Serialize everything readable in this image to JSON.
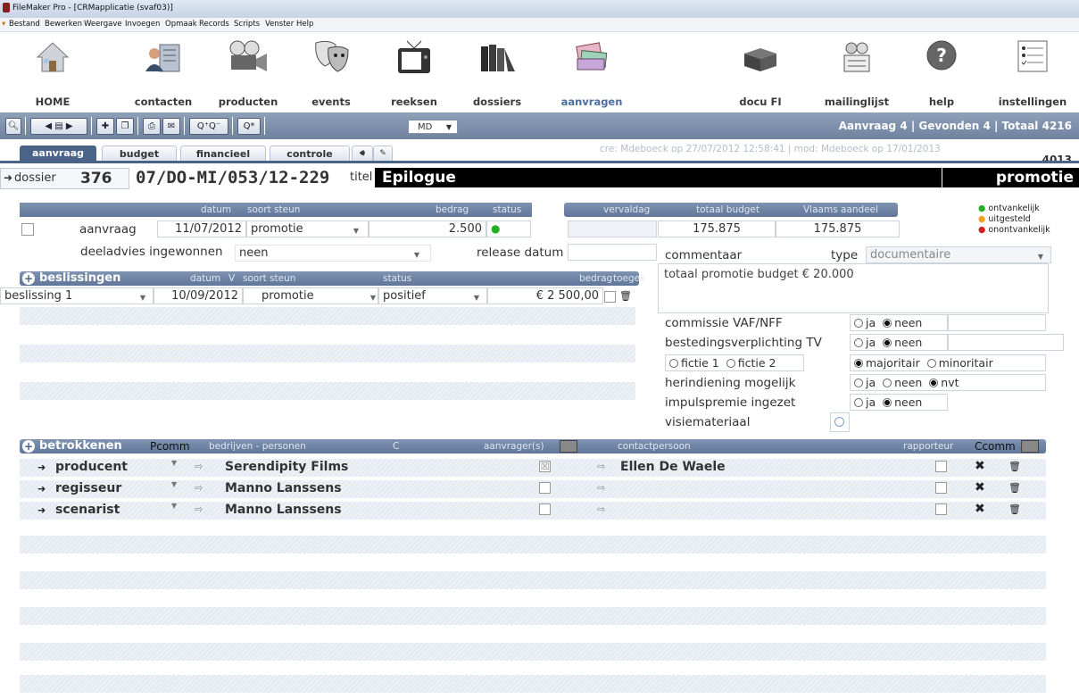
{
  "window": {
    "title": "FileMaker Pro - [CRMapplicatie (svaf03)]"
  },
  "menu": [
    "Bestand",
    "Bewerken",
    "Weergave",
    "Invoegen",
    "Opmaak",
    "Records",
    "Scripts",
    "Venster",
    "Help"
  ],
  "nav": [
    {
      "label": "HOME",
      "icon": "home-icon"
    },
    {
      "label": "contacten",
      "icon": "contacts-icon"
    },
    {
      "label": "producten",
      "icon": "film-camera-icon"
    },
    {
      "label": "events",
      "icon": "theater-masks-icon"
    },
    {
      "label": "reeksen",
      "icon": "television-icon"
    },
    {
      "label": "dossiers",
      "icon": "binders-icon"
    },
    {
      "label": "aanvragen",
      "icon": "documents-icon"
    },
    {
      "label": "docu FI",
      "icon": "boxes-icon"
    },
    {
      "label": "mailinglijst",
      "icon": "mailing-icon"
    },
    {
      "label": "help",
      "icon": "help-icon"
    },
    {
      "label": "instellingen",
      "icon": "settings-icon"
    }
  ],
  "toolbar": {
    "md_value": "MD",
    "counts": "Aanvraag 4 | Gevonden 4 | Totaal 4216"
  },
  "tabs": [
    "aanvraag",
    "budget",
    "financieel",
    "controle"
  ],
  "meta": {
    "created": "cre: Mdeboeck op 27/07/2012 12:58:41 | mod: Mdeboeck op 17/01/2013",
    "record_no": "4013"
  },
  "dossier": {
    "label": "dossier",
    "number": "376",
    "code": "07/DO-MI/053/12-229",
    "titel_label": "titel",
    "titel": "Epilogue",
    "type": "promotie"
  },
  "aanvraag": {
    "headers": {
      "datum": "datum",
      "soort_steun": "soort steun",
      "bedrag": "bedrag",
      "status": "status",
      "vervaldag": "vervaldag",
      "totaal_budget": "totaal budget",
      "vlaams_aandeel": "Vlaams aandeel"
    },
    "label": "aanvraag",
    "datum": "11/07/2012",
    "soort": "promotie",
    "bedrag": "2.500",
    "totaal_budget": "175.875",
    "vlaams_aandeel": "175.875",
    "deeladvies_label": "deeladvies ingewonnen",
    "deeladvies": "neen",
    "release_label": "release datum"
  },
  "legend": [
    {
      "text": "ontvankelijk",
      "color": "#22b022"
    },
    {
      "text": "uitgesteld",
      "color": "#f0a020"
    },
    {
      "text": "onontvankelijk",
      "color": "#d02020"
    }
  ],
  "commentaar": {
    "label": "commentaar",
    "type_label": "type",
    "type_value": "documentaire",
    "text": "totaal promotie budget € 20.000"
  },
  "beslissingen": {
    "title": "beslissingen",
    "headers": {
      "datum": "datum",
      "v": "V",
      "soort_steun": "soort steun",
      "status": "status",
      "bedrag": "bedrag",
      "toegek": "toegek"
    },
    "rows": [
      {
        "label": "beslissing 1",
        "datum": "10/09/2012",
        "soort": "promotie",
        "status": "positief",
        "bedrag": "€ 2 500,00"
      }
    ]
  },
  "options": {
    "vaf_label": "commissie VAF/NFF",
    "besteding_label": "bestedingsverplichting TV",
    "herindiening_label": "herindiening mogelijk",
    "impuls_label": "impulspremie ingezet",
    "visie_label": "visiemateriaal",
    "ja": "ja",
    "neen": "neen",
    "nvt": "nvt",
    "fictie1": "fictie 1",
    "fictie2": "fictie 2",
    "majoritair": "majoritair",
    "minoritair": "minoritair"
  },
  "betrokkenen": {
    "title": "betrokkenen",
    "headers": {
      "pcomm": "Pcomm",
      "bedrijven": "bedrijven - personen",
      "c": "C",
      "aanvragers": "aanvrager(s)",
      "contact": "contactpersoon",
      "rapporteur": "rapporteur",
      "ccomm": "Ccomm"
    },
    "rows": [
      {
        "role": "producent",
        "name": "Serendipity Films",
        "contact": "Ellen De Waele"
      },
      {
        "role": "regisseur",
        "name": "Manno Lanssens",
        "contact": ""
      },
      {
        "role": "scenarist",
        "name": "Manno Lanssens",
        "contact": ""
      }
    ]
  },
  "colors": {
    "accent": "#4a6489",
    "header_bar": "#6f829f",
    "active_nav": "#4a6fa1"
  }
}
